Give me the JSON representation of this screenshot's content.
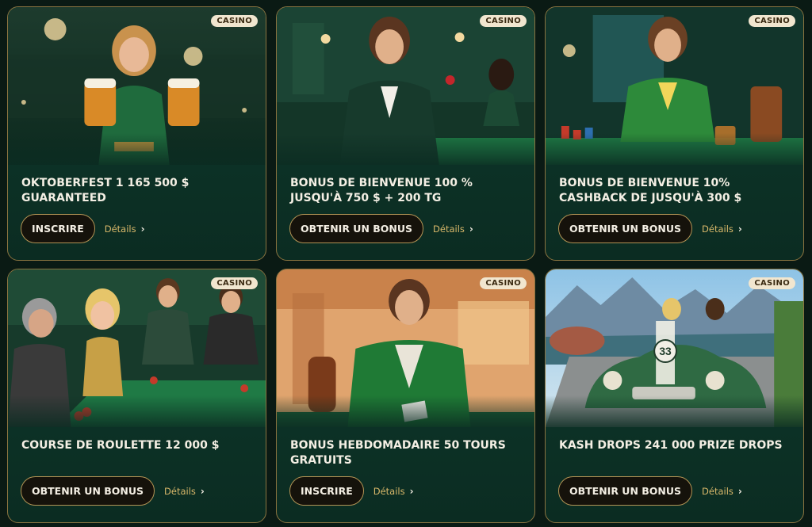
{
  "cards": [
    {
      "badge": "CASINO",
      "title": "OKTOBERFEST 1 165 500 $ GUARANTEED",
      "button": "INSCRIRE",
      "details": "Détails",
      "chevron": "›"
    },
    {
      "badge": "CASINO",
      "title": "BONUS DE BIENVENUE 100 % JUSQU'À 750 $ + 200 TG",
      "button": "OBTENIR UN BONUS",
      "details": "Détails",
      "chevron": "›"
    },
    {
      "badge": "CASINO",
      "title": "BONUS DE BIENVENUE 10% CASHBACK DE JUSQU'À 300 $",
      "button": "OBTENIR UN BONUS",
      "details": "Détails",
      "chevron": "›"
    },
    {
      "badge": "CASINO",
      "title": "COURSE DE ROULETTE 12 000 $",
      "button": "OBTENIR UN BONUS",
      "details": "Détails",
      "chevron": "›"
    },
    {
      "badge": "CASINO",
      "title": "BONUS HEBDOMADAIRE 50 TOURS GRATUITS",
      "button": "INSCRIRE",
      "details": "Détails",
      "chevron": "›"
    },
    {
      "badge": "CASINO",
      "title": "KASH DROPS 241 000 PRIZE DROPS",
      "button": "OBTENIR UN BONUS",
      "details": "Détails",
      "chevron": "›",
      "car_number": "33"
    }
  ],
  "colors": {
    "page_bg": "#0a1a14",
    "card_bg": "#0f3a2c",
    "card_border": "#8a7440",
    "button_border": "#b39455",
    "details_text": "#d9b86a",
    "badge_bg": "#f1e6cf"
  }
}
